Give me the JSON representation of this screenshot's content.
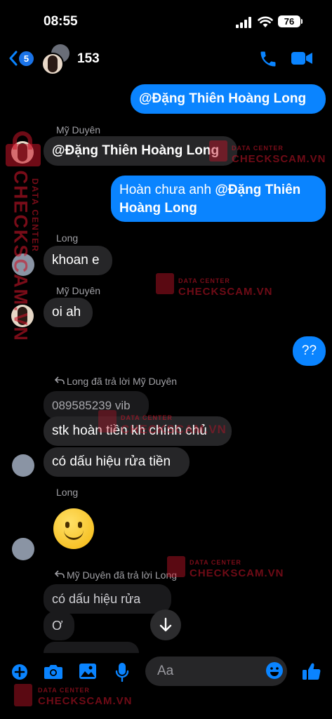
{
  "status_bar": {
    "time": "08:55",
    "battery": "76"
  },
  "header": {
    "back_badge": "5",
    "title": "153"
  },
  "messages": [
    {
      "type": "outgoing",
      "mention": "@Đặng Thiên Hoàng Long"
    },
    {
      "sender": "Mỹ Duyên",
      "mention": "@Đặng Thiên Hoàng Long"
    },
    {
      "type": "outgoing",
      "text": "Hoàn chưa anh ",
      "mention_line1": "@Đặng Thiên",
      "mention_line2": "Hoàng Long"
    },
    {
      "sender": "Long",
      "text": "khoan e"
    },
    {
      "sender": "Mỹ Duyên",
      "text": "oi ah"
    },
    {
      "type": "outgoing",
      "text": "??"
    },
    {
      "reply_note": "Long đã trả lời Mỹ Duyên",
      "quoted": "089585239 vib",
      "lines": [
        "stk hoàn tiền kh chính chủ",
        "có dấu hiệu rửa tiền"
      ]
    },
    {
      "sender": "Long",
      "emoji": "🙂"
    },
    {
      "reply_note": "Mỹ Duyên đã trả lời Long",
      "quoted_lines": [
        "có dấu hiệu rửa tiền",
        "Ơ"
      ]
    }
  ],
  "watermark": {
    "label": "DATA CENTER",
    "brand": "CHECKSCAM.VN",
    "vertical_label": "DATA CENTER",
    "vertical_brand": "CHECKSCAM.VN"
  },
  "composer": {
    "placeholder": "Aa"
  },
  "colors": {
    "accent": "#0a84ff",
    "incoming": "#262628",
    "watermark": "#c81428"
  }
}
